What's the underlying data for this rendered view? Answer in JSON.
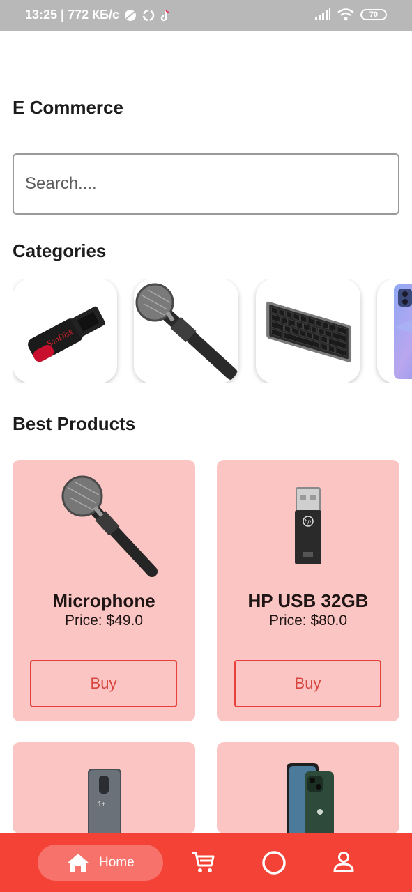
{
  "status_bar": {
    "time_speed": "13:25 | 772 КБ/с",
    "battery": "70",
    "icons": [
      "vpn-icon",
      "sync-icon",
      "tiktok-icon",
      "signal-icon",
      "wifi-icon",
      "battery-icon"
    ]
  },
  "app": {
    "title": "E Commerce"
  },
  "search": {
    "placeholder": "Search...."
  },
  "sections": {
    "categories": "Categories",
    "best_products": "Best Products"
  },
  "categories": [
    {
      "name": "usb-flash-drive",
      "icon": "usb-drive-image"
    },
    {
      "name": "microphone",
      "icon": "microphone-image"
    },
    {
      "name": "keyboard",
      "icon": "keyboard-image"
    },
    {
      "name": "smartphone",
      "icon": "phone-image"
    }
  ],
  "products": [
    {
      "name": "Microphone",
      "price": "Price: $49.0",
      "buy": "Buy"
    },
    {
      "name": "HP USB 32GB",
      "price": "Price: $80.0",
      "buy": "Buy"
    }
  ],
  "products_partial": [
    {
      "icon": "oneplus-phone-image"
    },
    {
      "icon": "iphone-green-image"
    }
  ],
  "bottom_nav": {
    "home_label": "Home",
    "items": [
      "home-icon",
      "cart-icon",
      "circle-icon",
      "profile-icon"
    ]
  },
  "colors": {
    "accent": "#f44336",
    "card_bg": "#fac5c2",
    "status_bar": "#b8b8b8"
  }
}
